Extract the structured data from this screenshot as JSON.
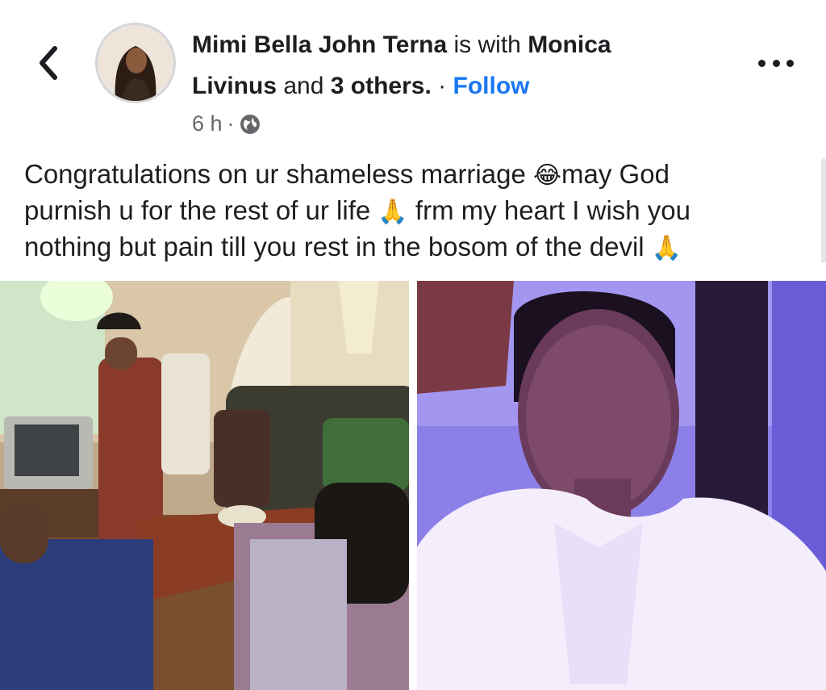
{
  "post": {
    "author": "Mimi Bella John Terna",
    "with_word": "is with",
    "tagged_first_name": "Monica",
    "tagged_last_name": "Livinus",
    "and_word": "and",
    "others": "3 others.",
    "separator": "·",
    "follow_label": "Follow",
    "time": "6 h",
    "time_separator": "·",
    "text_line_1": "Congratulations on ur shameless marriage ",
    "text_line_1b": "may God",
    "text_line_2": "purnish u for the rest of ur life ",
    "text_line_2b": " frm my heart I wish you",
    "text_line_3": "nothing but pain till you rest in the bosom of the devil ",
    "emoji_laugh": "😂",
    "emoji_pray": "🙏"
  },
  "icons": {
    "back": "back-chevron-icon",
    "more": "more-dots-icon",
    "audience": "globe-icon"
  },
  "colors": {
    "link": "#1877f2",
    "meta": "#65676b",
    "text": "#1c1e21"
  }
}
